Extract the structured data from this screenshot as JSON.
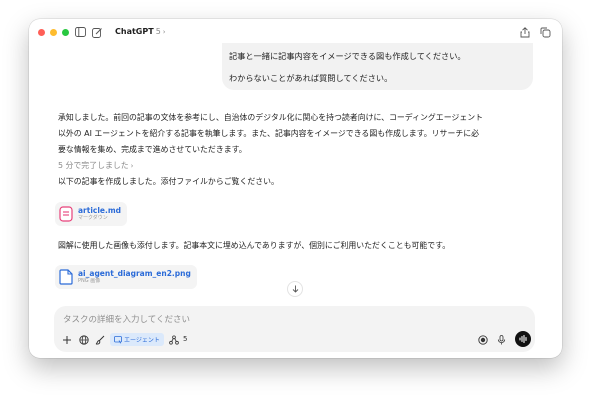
{
  "window": {
    "title": "ChatGPT",
    "version": "5",
    "title_chevron": "›"
  },
  "user_message": {
    "lines": [
      "記事と一緒に記事内容をイメージできる図も作成してください。",
      "わからないことがあれば質問してください。"
    ]
  },
  "assistant": {
    "intro_lines": [
      "承知しました。前回の記事の文体を参考にし、自治体のデジタル化に関心を持つ読者向けに、コーディングエージェント",
      "以外の AI エージェントを紹介する記事を執筆します。また、記事内容をイメージできる図も作成します。リサーチに必",
      "要な情報を集め、完成まで進めさせていただきます。"
    ],
    "completed_label": "5 分で完了しました",
    "completed_chevron": "›",
    "created_text": "以下の記事を作成しました。添付ファイルからご覧ください。",
    "file1": {
      "name": "article.md",
      "type": "マークダウン",
      "accent": "#e8417a"
    },
    "image_text": "図解に使用した画像も添付します。記事本文に埋め込んでありますが、個別にご利用いただくことも可能です。",
    "file2": {
      "name": "ai_agent_diagram_en2.png",
      "type": "PNG 画像",
      "accent": "#2b6bd8"
    }
  },
  "composer": {
    "placeholder": "タスクの詳細を入力してください",
    "agent_label": "エージェント",
    "count": "5"
  },
  "colors": {
    "link": "#2b6bd8",
    "chip_bg": "#dbe9fb",
    "bubble_bg": "#f2f2f2"
  },
  "icons": {
    "sidebar": "sidebar-toggle-icon",
    "new_chat": "new-chat-icon",
    "share": "share-icon",
    "copy": "copy-window-icon",
    "plus": "plus-icon",
    "globe": "globe-icon",
    "brush": "brush-icon",
    "agent": "agent-icon",
    "tools": "tools-icon",
    "record": "record-icon",
    "mic": "mic-icon",
    "voice": "voice-mode-icon",
    "scroll_down": "arrow-down-icon"
  }
}
